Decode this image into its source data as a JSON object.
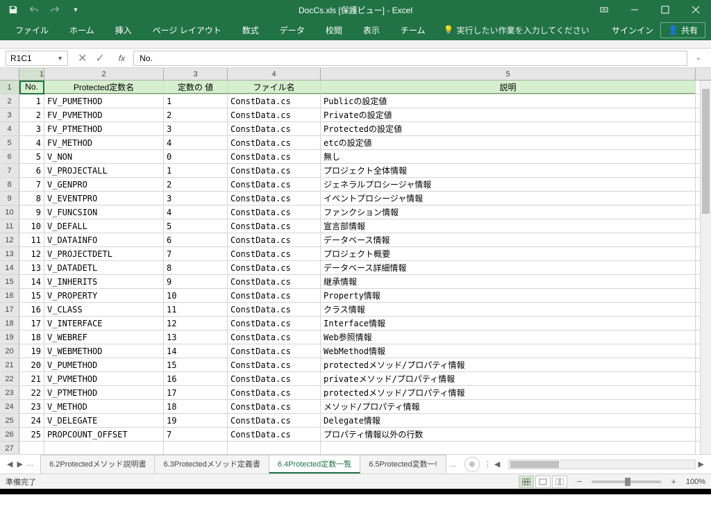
{
  "title": "DocCs.xls [保護ビュー] - Excel",
  "ribbon": {
    "tabs": [
      "ファイル",
      "ホーム",
      "挿入",
      "ページ レイアウト",
      "数式",
      "データ",
      "校閲",
      "表示",
      "チーム"
    ],
    "tellme": "実行したい作業を入力してください",
    "signin": "サインイン",
    "share": "共有"
  },
  "namebox": "R1C1",
  "formula": "No.",
  "column_numbers": [
    "1",
    "2",
    "3",
    "4",
    "5"
  ],
  "headers": [
    "No.",
    "Protected定数名",
    "定数の 値",
    "ファイル名",
    "説明"
  ],
  "rows": [
    {
      "n": "1",
      "no": "1",
      "name": "FV_PUMETHOD",
      "val": "1",
      "file": "ConstData.cs",
      "desc": "Publicの設定値"
    },
    {
      "n": "2",
      "no": "2",
      "name": "FV_PVMETHOD",
      "val": "2",
      "file": "ConstData.cs",
      "desc": "Privateの設定値"
    },
    {
      "n": "3",
      "no": "3",
      "name": "FV_PTMETHOD",
      "val": "3",
      "file": "ConstData.cs",
      "desc": "Protectedの設定値"
    },
    {
      "n": "4",
      "no": "4",
      "name": "FV_METHOD",
      "val": "4",
      "file": "ConstData.cs",
      "desc": "etcの設定値"
    },
    {
      "n": "5",
      "no": "5",
      "name": "V_NON",
      "val": "0",
      "file": "ConstData.cs",
      "desc": "無し"
    },
    {
      "n": "6",
      "no": "6",
      "name": "V_PROJECTALL",
      "val": "1",
      "file": "ConstData.cs",
      "desc": "プロジェクト全体情報"
    },
    {
      "n": "7",
      "no": "7",
      "name": "V_GENPRO",
      "val": "2",
      "file": "ConstData.cs",
      "desc": "ジェネラルプロシージャ情報"
    },
    {
      "n": "8",
      "no": "8",
      "name": "V_EVENTPRO",
      "val": "3",
      "file": "ConstData.cs",
      "desc": "イベントプロシージャ情報"
    },
    {
      "n": "9",
      "no": "9",
      "name": "V_FUNCSION",
      "val": "4",
      "file": "ConstData.cs",
      "desc": "ファンクション情報"
    },
    {
      "n": "10",
      "no": "10",
      "name": "V_DEFALL",
      "val": "5",
      "file": "ConstData.cs",
      "desc": "宣言部情報"
    },
    {
      "n": "11",
      "no": "11",
      "name": "V_DATAINFO",
      "val": "6",
      "file": "ConstData.cs",
      "desc": "データベース情報"
    },
    {
      "n": "12",
      "no": "12",
      "name": "V_PROJECTDETL",
      "val": "7",
      "file": "ConstData.cs",
      "desc": "プロジェクト概要"
    },
    {
      "n": "13",
      "no": "13",
      "name": "V_DATADETL",
      "val": "8",
      "file": "ConstData.cs",
      "desc": "データベース詳細情報"
    },
    {
      "n": "14",
      "no": "14",
      "name": "V_INHERITS",
      "val": "9",
      "file": "ConstData.cs",
      "desc": "継承情報"
    },
    {
      "n": "15",
      "no": "15",
      "name": "V_PROPERTY",
      "val": "10",
      "file": "ConstData.cs",
      "desc": "Property情報"
    },
    {
      "n": "16",
      "no": "16",
      "name": "V_CLASS",
      "val": "11",
      "file": "ConstData.cs",
      "desc": "クラス情報"
    },
    {
      "n": "17",
      "no": "17",
      "name": "V_INTERFACE",
      "val": "12",
      "file": "ConstData.cs",
      "desc": "Interface情報"
    },
    {
      "n": "18",
      "no": "18",
      "name": "V_WEBREF",
      "val": "13",
      "file": "ConstData.cs",
      "desc": "Web参照情報"
    },
    {
      "n": "19",
      "no": "19",
      "name": "V_WEBMETHOD",
      "val": "14",
      "file": "ConstData.cs",
      "desc": "WebMethod情報"
    },
    {
      "n": "20",
      "no": "20",
      "name": "V_PUMETHOD",
      "val": "15",
      "file": "ConstData.cs",
      "desc": "protectedメソッド/プロパティ情報"
    },
    {
      "n": "21",
      "no": "21",
      "name": "V_PVMETHOD",
      "val": "16",
      "file": "ConstData.cs",
      "desc": "privateメソッド/プロパティ情報"
    },
    {
      "n": "22",
      "no": "22",
      "name": "V_PTMETHOD",
      "val": "17",
      "file": "ConstData.cs",
      "desc": "protectedメソッド/プロパティ情報"
    },
    {
      "n": "23",
      "no": "23",
      "name": "V_METHOD",
      "val": "18",
      "file": "ConstData.cs",
      "desc": "メソッド/プロパティ情報"
    },
    {
      "n": "24",
      "no": "24",
      "name": "V_DELEGATE",
      "val": "19",
      "file": "ConstData.cs",
      "desc": "Delegate情報"
    },
    {
      "n": "25",
      "no": "25",
      "name": "PROPCOUNT_OFFSET",
      "val": "7",
      "file": "ConstData.cs",
      "desc": "プロパティ情報以外の行数"
    }
  ],
  "empty_rows": [
    "27"
  ],
  "sheet_tabs": {
    "ellipsis": "...",
    "items": [
      "6.2Protectedメソッド説明書",
      "6.3Protectedメソッド定義書",
      "6.4Protected定数一覧",
      "6.5Protected変数一!"
    ],
    "active_index": 2,
    "more": "..."
  },
  "status": {
    "ready": "準備完了",
    "zoom": "100%"
  }
}
